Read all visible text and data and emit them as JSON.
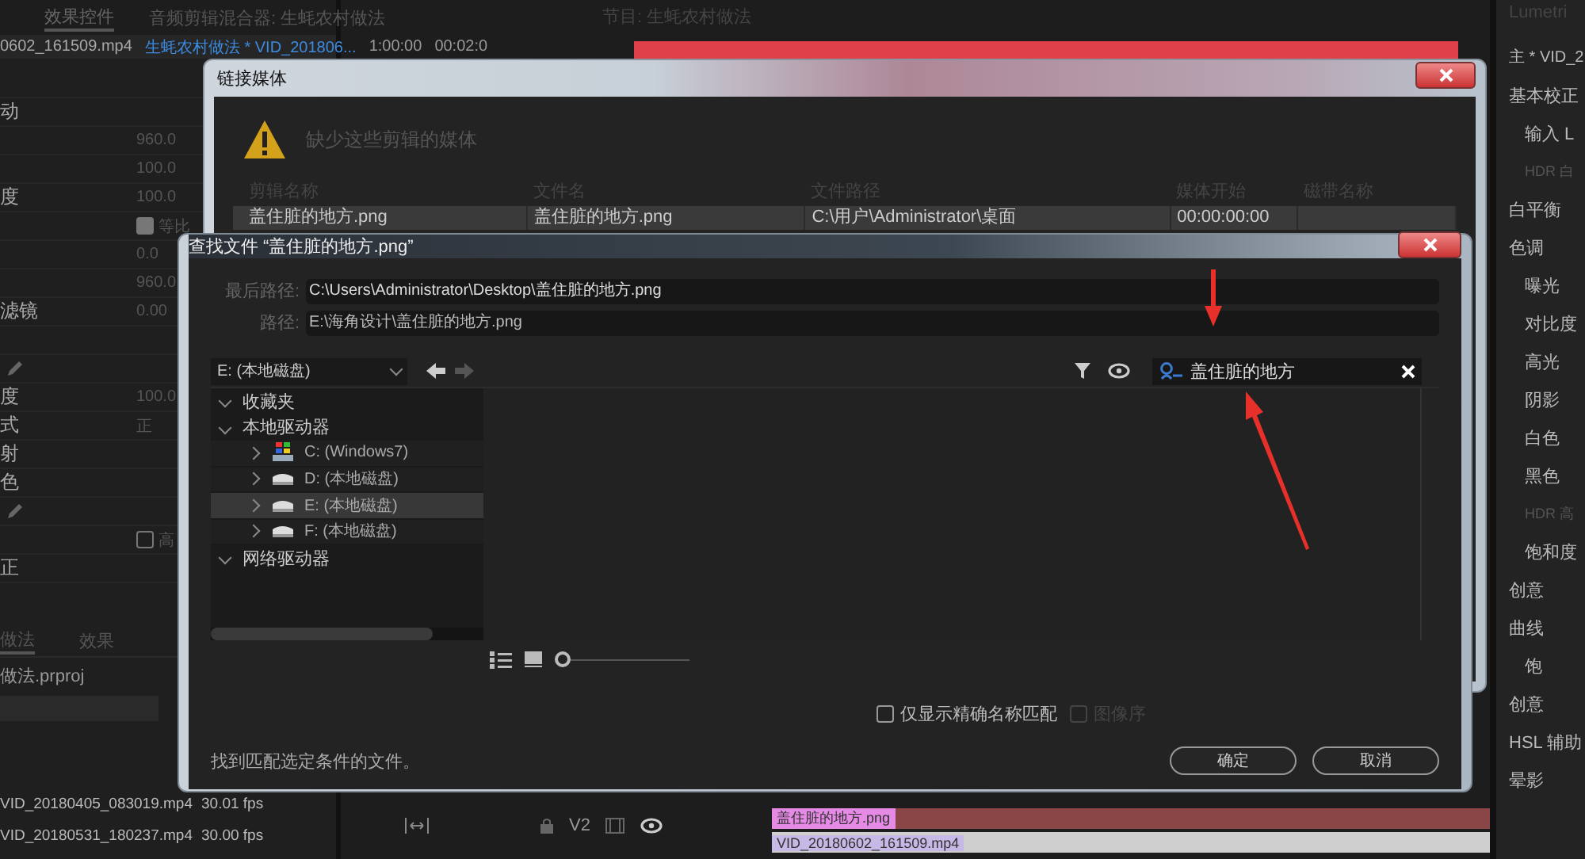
{
  "app": {
    "tabs": [
      {
        "label": "效果控件",
        "selected": true
      },
      {
        "label": "音频剪辑混合器: 生蚝农村做法",
        "selected": false
      },
      {
        "label": "节目: 生蚝农村做法",
        "selected": false
      }
    ]
  },
  "effect_controls": {
    "source": "0602_161509.mp4",
    "sequence": "生蚝农村做法 * VID_201806...",
    "time_start": "1:00:00",
    "time_end": "00:02:0",
    "rows": [
      {
        "kind": "heading",
        "label": "动"
      },
      {
        "kind": "value",
        "value": "960.0"
      },
      {
        "kind": "value",
        "value": "100.0"
      },
      {
        "kind": "value",
        "label": "度",
        "value": "100.0"
      },
      {
        "kind": "checkbox",
        "label": "等比",
        "checked": true
      },
      {
        "kind": "value",
        "value": "0.0"
      },
      {
        "kind": "value",
        "value": "960.0"
      },
      {
        "kind": "value",
        "label": "滤镜",
        "value": "0.00"
      },
      {
        "kind": "blank"
      },
      {
        "kind": "pencil"
      },
      {
        "kind": "value",
        "label": "度",
        "value": "100.0"
      },
      {
        "kind": "select",
        "label": "式",
        "value": "正"
      },
      {
        "kind": "value",
        "label": "射"
      },
      {
        "kind": "value",
        "label": "色"
      },
      {
        "kind": "pencil"
      },
      {
        "kind": "checkbox",
        "label": "高",
        "checked": false
      },
      {
        "kind": "heading",
        "label": "正"
      }
    ]
  },
  "project": {
    "tabs": [
      {
        "label": "做法",
        "selected": true
      },
      {
        "label": "效果",
        "selected": false
      }
    ],
    "file": "做法.prproj",
    "items": [
      {
        "name": "VID_20180405_083019.mp4",
        "rate": "30.01 fps"
      },
      {
        "name": "VID_20180531_180237.mp4",
        "rate": "30.00 fps"
      }
    ]
  },
  "timeline": {
    "track": "V2",
    "clips": [
      {
        "name": "盖住脏的地方.png",
        "kind": "graphic"
      },
      {
        "name": "VID_20180602_161509.mp4",
        "kind": "video"
      }
    ]
  },
  "lumetri": {
    "title": "Lumetri",
    "items": [
      {
        "label": "主 * VID_2",
        "kind": "header"
      },
      {
        "label": "基本校正",
        "kind": "section"
      },
      {
        "label": "输入 L",
        "kind": "sub"
      },
      {
        "label": "HDR 白",
        "kind": "dim"
      },
      {
        "label": "白平衡",
        "kind": "section"
      },
      {
        "label": "色调",
        "kind": "section"
      },
      {
        "label": "曝光",
        "kind": "sub"
      },
      {
        "label": "对比度",
        "kind": "sub"
      },
      {
        "label": "高光",
        "kind": "sub"
      },
      {
        "label": "阴影",
        "kind": "sub"
      },
      {
        "label": "白色",
        "kind": "sub"
      },
      {
        "label": "黑色",
        "kind": "sub"
      },
      {
        "label": "HDR 高",
        "kind": "dim"
      },
      {
        "label": "饱和度",
        "kind": "sub"
      },
      {
        "label": "创意",
        "kind": "section"
      },
      {
        "label": "曲线",
        "kind": "section"
      },
      {
        "label": "饱",
        "kind": "sub"
      },
      {
        "label": "创意",
        "kind": "section"
      },
      {
        "label": "HSL 辅助",
        "kind": "section"
      },
      {
        "label": "晕影",
        "kind": "section"
      }
    ]
  },
  "link_dialog": {
    "title": "链接媒体",
    "message": "缺少这些剪辑的媒体",
    "columns": [
      "剪辑名称",
      "文件名",
      "文件路径",
      "媒体开始",
      "磁带名称"
    ],
    "rows": [
      {
        "cells": [
          "盖住脏的地方.png",
          "盖住脏的地方.png",
          "C:\\用户\\Administrator\\桌面",
          "00:00:00:00"
        ],
        "selected": true
      }
    ]
  },
  "find_dialog": {
    "title": "查找文件 “盖住脏的地方.png”",
    "last_path_label": "最后路径:",
    "last_path": "C:\\Users\\Administrator\\Desktop\\盖住脏的地方.png",
    "path_label": "路径:",
    "path": "E:\\海角设计\\盖住脏的地方.png",
    "drive": "E: (本地磁盘)",
    "search": "盖住脏的地方",
    "tree": [
      {
        "label": "收藏夹",
        "expanded": true,
        "selected": false
      },
      {
        "label": "本地驱动器",
        "expanded": true,
        "selected": false,
        "children": [
          {
            "label": "C: (Windows7)",
            "kind": "system",
            "expanded": false,
            "selected": false
          },
          {
            "label": "D: (本地磁盘)",
            "kind": "disk",
            "expanded": false,
            "selected": false
          },
          {
            "label": "E: (本地磁盘)",
            "kind": "disk",
            "expanded": false,
            "selected": true
          },
          {
            "label": "F: (本地磁盘)",
            "kind": "disk",
            "expanded": false,
            "selected": false
          }
        ]
      },
      {
        "label": "网络驱动器",
        "expanded": true,
        "selected": false
      }
    ],
    "options": [
      {
        "label": "仅显示精确名称匹配",
        "checked": false,
        "disabled": false
      },
      {
        "label": "图像序",
        "checked": false,
        "disabled": true
      }
    ],
    "zoom": {
      "level": 0
    },
    "status": "找到匹配选定条件的文件。",
    "buttons": [
      "确定",
      "取消"
    ]
  }
}
